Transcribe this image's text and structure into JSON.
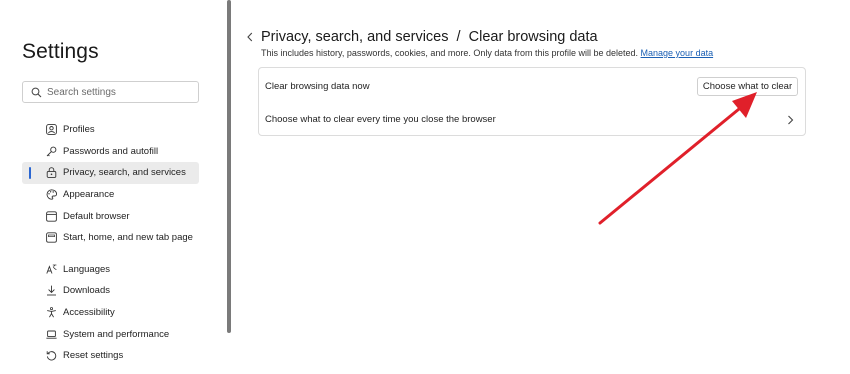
{
  "sidebar": {
    "title": "Settings",
    "search": {
      "placeholder": "Search settings",
      "value": ""
    },
    "items": [
      {
        "label": "Profiles",
        "icon": "profile-icon",
        "active": false
      },
      {
        "label": "Passwords and autofill",
        "icon": "key-icon",
        "active": false
      },
      {
        "label": "Privacy, search, and services",
        "icon": "lock-icon",
        "active": true
      },
      {
        "label": "Appearance",
        "icon": "palette-icon",
        "active": false
      },
      {
        "label": "Default browser",
        "icon": "browser-icon",
        "active": false
      },
      {
        "label": "Start, home, and new tab page",
        "icon": "home-page-icon",
        "active": false
      },
      {
        "label": "Languages",
        "icon": "languages-icon",
        "active": false
      },
      {
        "label": "Downloads",
        "icon": "download-icon",
        "active": false
      },
      {
        "label": "Accessibility",
        "icon": "accessibility-icon",
        "active": false
      },
      {
        "label": "System and performance",
        "icon": "laptop-icon",
        "active": false
      },
      {
        "label": "Reset settings",
        "icon": "reset-icon",
        "active": false
      }
    ]
  },
  "main": {
    "title": "Privacy, search, and services  /  Clear browsing data",
    "description": "This includes history, passwords, cookies, and more. Only data from this profile will be deleted.",
    "description_link": "Manage your data",
    "rows": {
      "clear_now_label": "Clear browsing data now",
      "clear_button_label": "Choose what to clear",
      "clear_on_close_label": "Choose what to clear every time you close the browser"
    }
  },
  "colors": {
    "accent": "#2a66d1",
    "link": "#1a5fb4",
    "annotation_arrow": "#e0202a"
  }
}
